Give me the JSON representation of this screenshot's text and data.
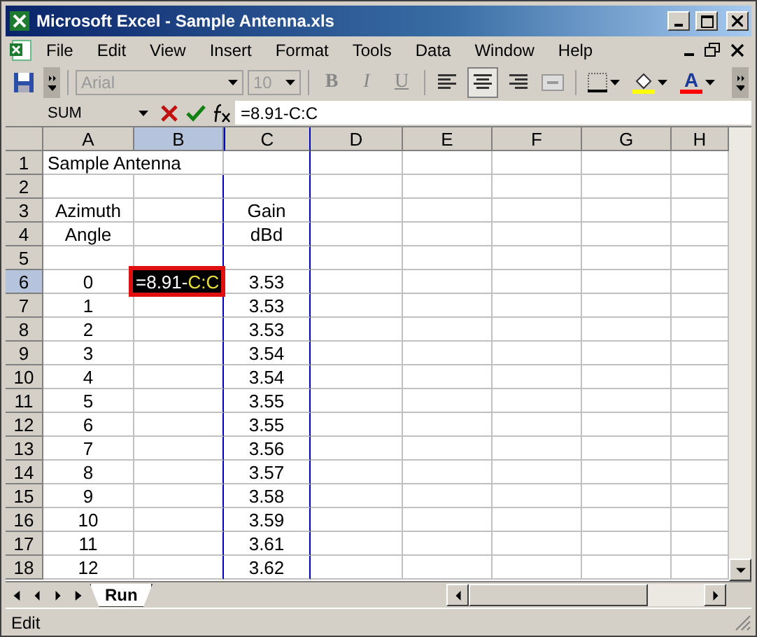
{
  "window": {
    "title": "Microsoft Excel - Sample Antenna.xls"
  },
  "menu": [
    {
      "label": "File"
    },
    {
      "label": "Edit"
    },
    {
      "label": "View"
    },
    {
      "label": "Insert"
    },
    {
      "label": "Format"
    },
    {
      "label": "Tools"
    },
    {
      "label": "Data"
    },
    {
      "label": "Window"
    },
    {
      "label": "Help"
    }
  ],
  "toolbar": {
    "font": "Arial",
    "size": "10",
    "disabled": true,
    "bold": "B",
    "italic": "I",
    "underline": "U",
    "align_center_selected": true,
    "font_color_glyph": "A"
  },
  "formula_bar": {
    "name_box": "SUM",
    "formula": "=8.91-C:C"
  },
  "columns": [
    {
      "label": "A",
      "selected": false,
      "referenced": false
    },
    {
      "label": "B",
      "selected": true,
      "referenced": false
    },
    {
      "label": "C",
      "selected": false,
      "referenced": true
    },
    {
      "label": "D",
      "selected": false,
      "referenced": false
    },
    {
      "label": "E",
      "selected": false,
      "referenced": false
    },
    {
      "label": "F",
      "selected": false,
      "referenced": false
    },
    {
      "label": "G",
      "selected": false,
      "referenced": false
    },
    {
      "label": "H",
      "selected": false,
      "referenced": false
    }
  ],
  "rows": [
    {
      "number": "1",
      "selected": false,
      "a": "Sample Antenna",
      "kind": "title"
    },
    {
      "number": "2",
      "selected": false
    },
    {
      "number": "3",
      "selected": false,
      "a": "Azimuth",
      "c": "Gain"
    },
    {
      "number": "4",
      "selected": false,
      "a": "Angle",
      "c": "dBd"
    },
    {
      "number": "5",
      "selected": false
    },
    {
      "number": "6",
      "selected": true,
      "a": "0",
      "c": "3.53",
      "editing": [
        {
          "text": "=8.91-",
          "kind": "plain"
        },
        {
          "text": "C:C",
          "kind": "reference"
        }
      ]
    },
    {
      "number": "7",
      "selected": false,
      "a": "1",
      "c": "3.53"
    },
    {
      "number": "8",
      "selected": false,
      "a": "2",
      "c": "3.53"
    },
    {
      "number": "9",
      "selected": false,
      "a": "3",
      "c": "3.54"
    },
    {
      "number": "10",
      "selected": false,
      "a": "4",
      "c": "3.54"
    },
    {
      "number": "11",
      "selected": false,
      "a": "5",
      "c": "3.55"
    },
    {
      "number": "12",
      "selected": false,
      "a": "6",
      "c": "3.55"
    },
    {
      "number": "13",
      "selected": false,
      "a": "7",
      "c": "3.56"
    },
    {
      "number": "14",
      "selected": false,
      "a": "8",
      "c": "3.57"
    },
    {
      "number": "15",
      "selected": false,
      "a": "9",
      "c": "3.58"
    },
    {
      "number": "16",
      "selected": false,
      "a": "10",
      "c": "3.59"
    },
    {
      "number": "17",
      "selected": false,
      "a": "11",
      "c": "3.61"
    },
    {
      "number": "18",
      "selected": false,
      "a": "12",
      "c": "3.62"
    }
  ],
  "sheet_tabs": [
    {
      "label": "Run",
      "selected": true
    }
  ],
  "status_bar": {
    "mode": "Edit"
  }
}
